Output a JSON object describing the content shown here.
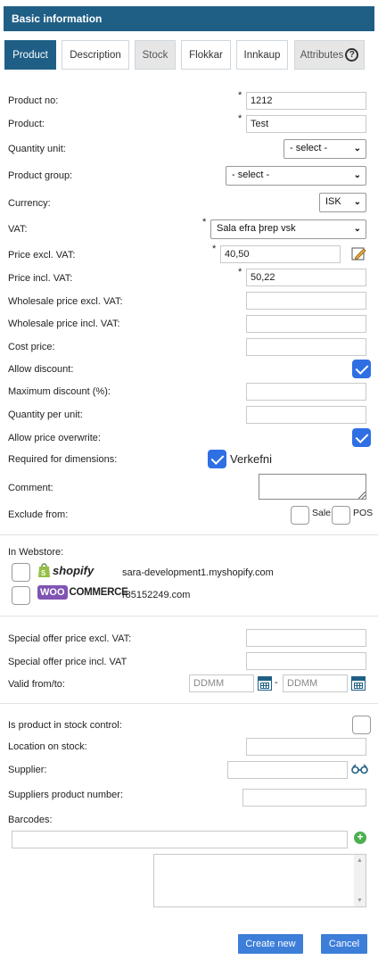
{
  "header": {
    "title": "Basic information"
  },
  "tabs": [
    {
      "label": "Product"
    },
    {
      "label": "Description"
    },
    {
      "label": "Stock"
    },
    {
      "label": "Flokkar"
    },
    {
      "label": "Innkaup"
    },
    {
      "label": "Attributes"
    }
  ],
  "required_mark": "*",
  "fields": {
    "product_no": {
      "label": "Product no:",
      "value": "1212"
    },
    "product": {
      "label": "Product:",
      "value": "Test"
    },
    "quantity_unit": {
      "label": "Quantity unit:",
      "value": "- select -"
    },
    "product_group": {
      "label": "Product group:",
      "value": "- select -"
    },
    "currency": {
      "label": "Currency:",
      "value": "ISK"
    },
    "vat": {
      "label": "VAT:",
      "value": "Sala efra þrep vsk"
    },
    "price_excl": {
      "label": "Price excl. VAT:",
      "value": "40,50"
    },
    "price_incl": {
      "label": "Price incl. VAT:",
      "value": "50,22"
    },
    "wholesale_excl": {
      "label": "Wholesale price excl. VAT:",
      "value": ""
    },
    "wholesale_incl": {
      "label": "Wholesale price incl. VAT:",
      "value": ""
    },
    "cost_price": {
      "label": "Cost price:",
      "value": ""
    },
    "allow_discount": {
      "label": "Allow discount:",
      "checked": true
    },
    "max_discount": {
      "label": "Maximum discount (%):",
      "value": ""
    },
    "qty_per_unit": {
      "label": "Quantity per unit:",
      "value": ""
    },
    "allow_price_overwrite": {
      "label": "Allow price overwrite:",
      "checked": true
    },
    "required_dimensions": {
      "label": "Required for dimensions:",
      "option": "Verkefni",
      "checked": true
    },
    "comment": {
      "label": "Comment:",
      "value": ""
    },
    "exclude_from": {
      "label": "Exclude from:",
      "options": [
        "Sale",
        "POS"
      ]
    }
  },
  "webstore": {
    "label": "In Webstore:",
    "stores": [
      {
        "logo": "shopify",
        "logo_text": "shopify",
        "url": "sara-development1.myshopify.com"
      },
      {
        "logo": "woocommerce",
        "logo_text_a": "WOO",
        "logo_text_b": "COMMERCE",
        "url": "r85152249.com"
      }
    ]
  },
  "special_offer": {
    "excl_label": "Special offer price excl. VAT:",
    "incl_label": "Special offer price incl. VAT",
    "valid_label": "Valid from/to:",
    "from_placeholder": "DDMM",
    "to_placeholder": "DDMM",
    "dash": "-"
  },
  "stock": {
    "in_stock_control": "Is product in stock control:",
    "location": "Location on stock:",
    "supplier": "Supplier:",
    "supplier_product_number": "Suppliers product number:",
    "barcodes": "Barcodes:"
  },
  "buttons": {
    "create": "Create new",
    "cancel": "Cancel"
  },
  "colors": {
    "header": "#1f5f86",
    "checkbox": "#2f6fe4",
    "button": "#3d7ed9",
    "add_icon": "#4caf50"
  }
}
